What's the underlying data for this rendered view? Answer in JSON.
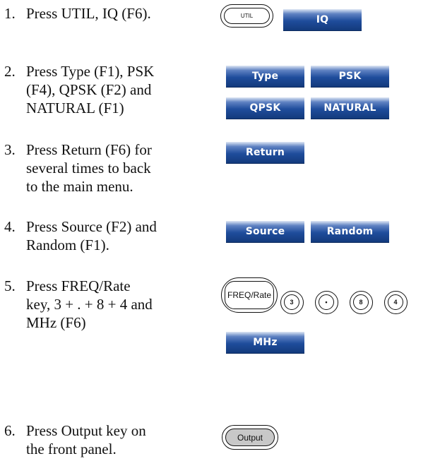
{
  "steps": [
    {
      "num": "1.",
      "lines": [
        "Press UTIL, IQ (F6)."
      ]
    },
    {
      "num": "2.",
      "lines": [
        "Press Type (F1), PSK",
        "(F4), QPSK (F2) and",
        "NATURAL (F1)"
      ]
    },
    {
      "num": "3.",
      "lines": [
        "Press Return (F6) for",
        "several times to back",
        "to the main menu."
      ]
    },
    {
      "num": "4.",
      "lines": [
        "Press Source (F2) and",
        "Random (F1)."
      ]
    },
    {
      "num": "5.",
      "lines": [
        "Press FREQ/Rate",
        "key, 3 + . + 8 + 4 and",
        "MHz (F6)"
      ]
    },
    {
      "num": "6.",
      "lines": [
        "Press Output key on",
        "the front panel."
      ]
    }
  ],
  "keys": {
    "util": "UTIL",
    "iq": "IQ",
    "type": "Type",
    "psk": "PSK",
    "qpsk": "QPSK",
    "natural": "NATURAL",
    "return": "Return",
    "source": "Source",
    "random": "Random",
    "freq_rate": "FREQ/Rate",
    "num_3": "3",
    "num_dot": "•",
    "num_8": "8",
    "num_4": "4",
    "mhz": "MHz",
    "output": "Output"
  }
}
